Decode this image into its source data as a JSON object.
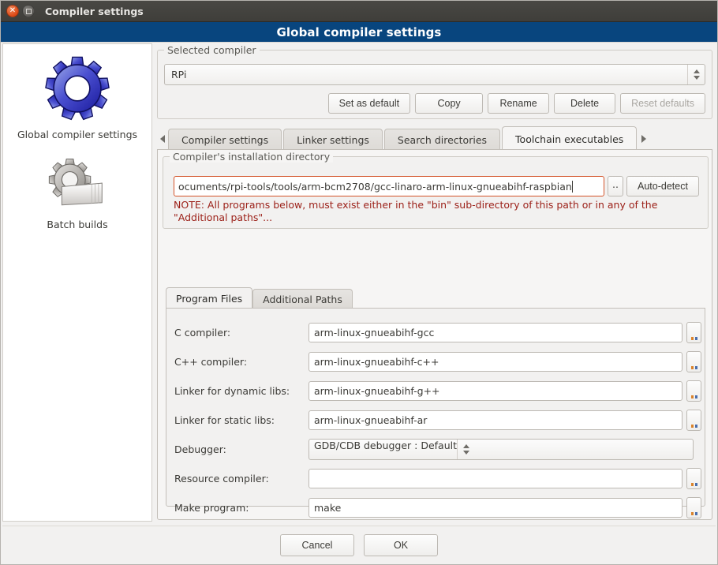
{
  "window": {
    "title": "Compiler settings",
    "close_icon": "close-icon",
    "maximize_icon": "maximize-icon"
  },
  "header": {
    "title": "Global compiler settings",
    "accent_color": "#08457e"
  },
  "sidebar": {
    "items": [
      {
        "label": "Global compiler settings",
        "icon": "gear-icon"
      },
      {
        "label": "Batch builds",
        "icon": "gear-documents-icon"
      }
    ]
  },
  "selected_compiler": {
    "group_title": "Selected compiler",
    "value": "RPi",
    "buttons": [
      {
        "label": "Set as default",
        "disabled": false
      },
      {
        "label": "Copy",
        "disabled": false
      },
      {
        "label": "Rename",
        "disabled": false
      },
      {
        "label": "Delete",
        "disabled": false
      },
      {
        "label": "Reset defaults",
        "disabled": true
      }
    ]
  },
  "tabs": {
    "scroll_left_icon": "chevron-left-icon",
    "scroll_right_icon": "chevron-right-icon",
    "items": [
      {
        "label": "Compiler settings",
        "active": false
      },
      {
        "label": "Linker settings",
        "active": false
      },
      {
        "label": "Search directories",
        "active": false
      },
      {
        "label": "Toolchain executables",
        "active": true
      }
    ]
  },
  "install_dir": {
    "group_title": "Compiler's installation directory",
    "value": "ocuments/rpi-tools/tools/arm-bcm2708/gcc-linaro-arm-linux-gnueabihf-raspbian",
    "browse_label": "..",
    "autodetect_label": "Auto-detect",
    "note": "NOTE: All programs below, must exist either in the \"bin\" sub-directory of this path or in any of the \"Additional paths\"...",
    "note_color": "#9c2119",
    "focus_border_color": "#d4542a"
  },
  "inner_tabs": {
    "items": [
      {
        "label": "Program Files",
        "active": true
      },
      {
        "label": "Additional Paths",
        "active": false
      }
    ]
  },
  "program_files": {
    "fields": [
      {
        "label": "C compiler:",
        "value": "arm-linux-gnueabihf-gcc",
        "type": "text",
        "browse": true
      },
      {
        "label": "C++ compiler:",
        "value": "arm-linux-gnueabihf-c++",
        "type": "text",
        "browse": true
      },
      {
        "label": "Linker for dynamic libs:",
        "value": "arm-linux-gnueabihf-g++",
        "type": "text",
        "browse": true
      },
      {
        "label": "Linker for static libs:",
        "value": "arm-linux-gnueabihf-ar",
        "type": "text",
        "browse": true
      },
      {
        "label": "Debugger:",
        "value": "GDB/CDB debugger : Default",
        "type": "combo",
        "browse": false
      },
      {
        "label": "Resource compiler:",
        "value": "",
        "type": "text",
        "browse": true
      },
      {
        "label": "Make program:",
        "value": "make",
        "type": "text",
        "browse": true
      }
    ]
  },
  "footer": {
    "cancel_label": "Cancel",
    "ok_label": "OK"
  }
}
